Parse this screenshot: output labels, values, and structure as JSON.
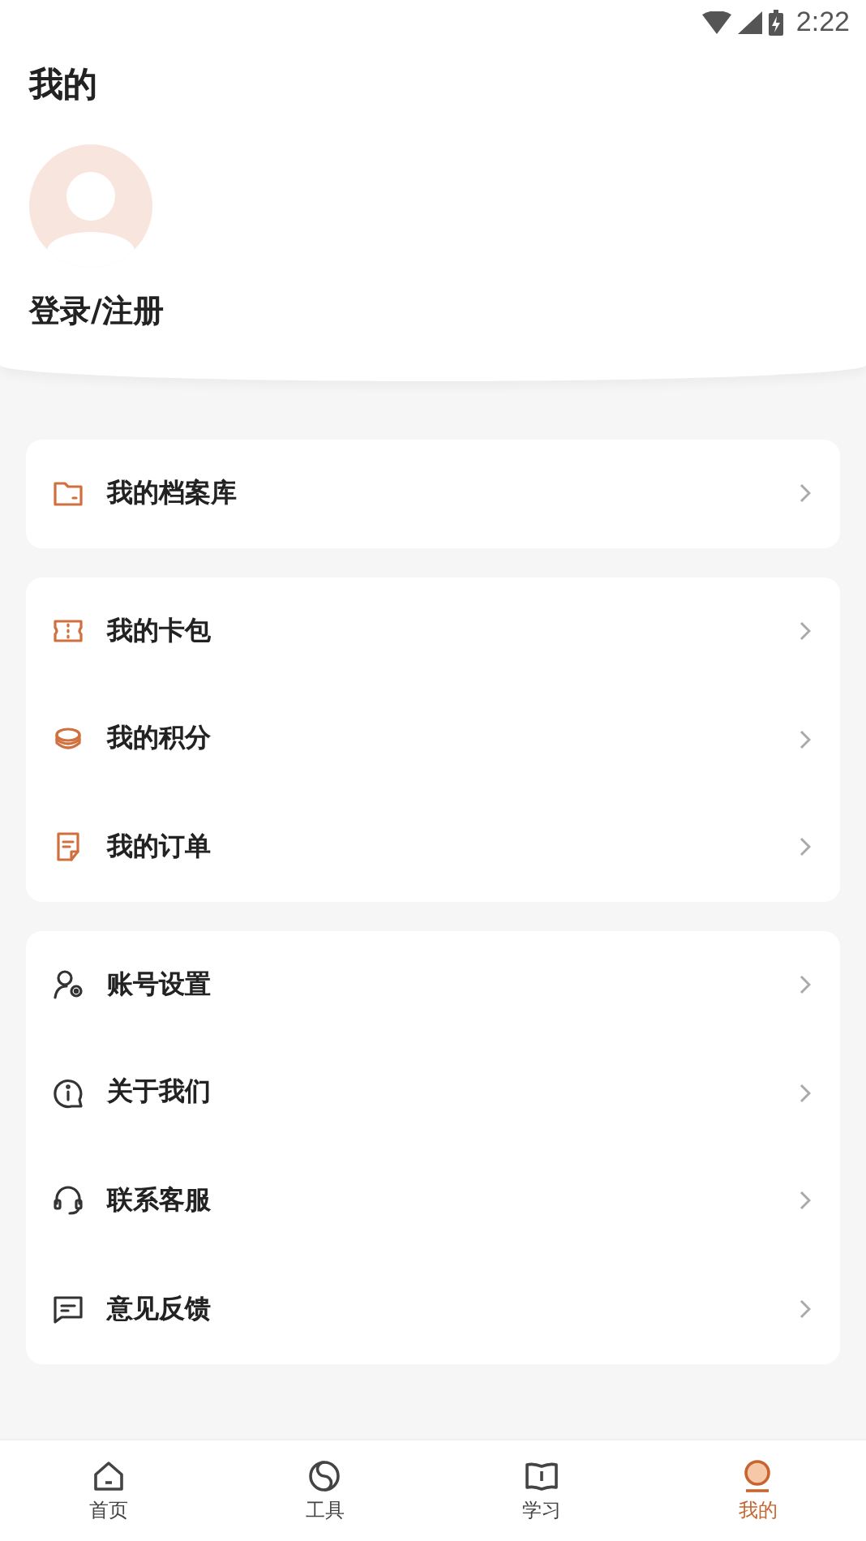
{
  "status_bar": {
    "time": "2:22"
  },
  "header": {
    "title": "我的",
    "login": "登录/注册"
  },
  "menu_groups": [
    {
      "items": [
        {
          "label": "我的档案库"
        }
      ]
    },
    {
      "items": [
        {
          "label": "我的卡包"
        },
        {
          "label": "我的积分"
        },
        {
          "label": "我的订单"
        }
      ]
    },
    {
      "items": [
        {
          "label": "账号设置"
        },
        {
          "label": "关于我们"
        },
        {
          "label": "联系客服"
        },
        {
          "label": "意见反馈"
        }
      ]
    }
  ],
  "bottom_nav": [
    {
      "label": "首页",
      "selected": false
    },
    {
      "label": "工具",
      "selected": false
    },
    {
      "label": "学习",
      "selected": false
    },
    {
      "label": "我的",
      "selected": true
    }
  ]
}
